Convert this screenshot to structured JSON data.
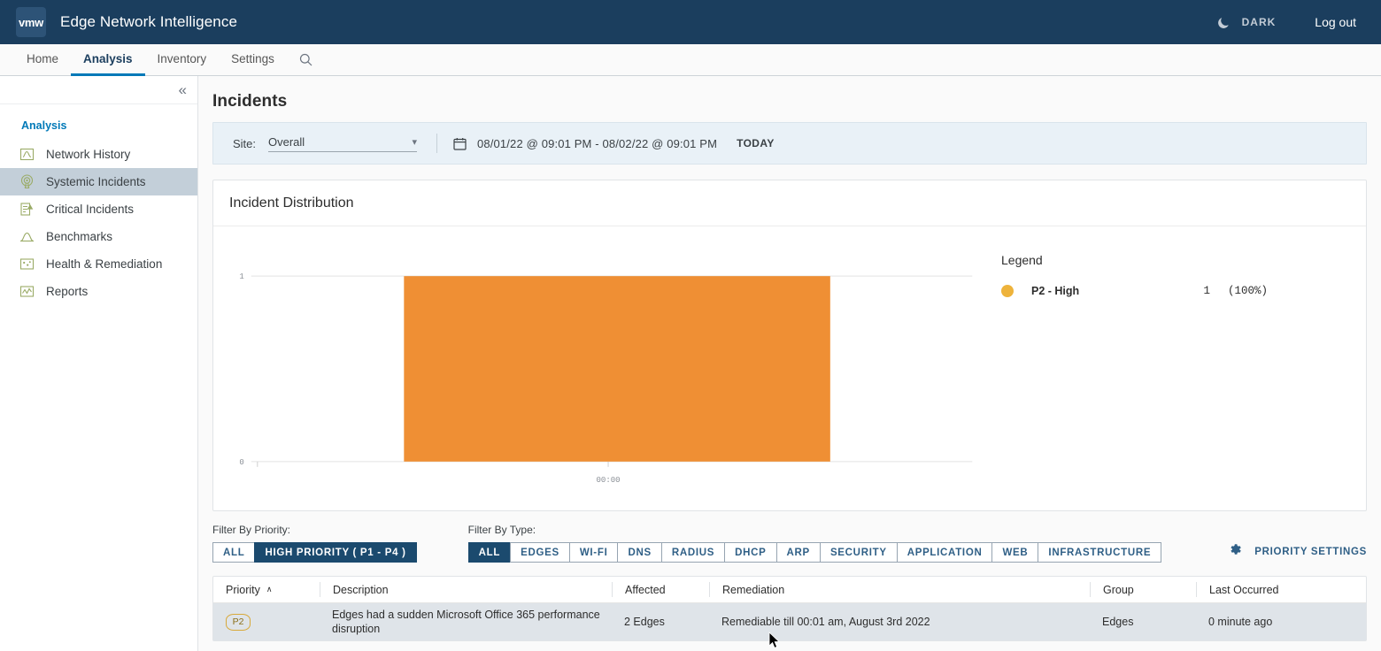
{
  "header": {
    "logo_text": "vmw",
    "app_title": "Edge Network Intelligence",
    "dark_label": "DARK",
    "logout_label": "Log out",
    "moon_icon": "moon-icon"
  },
  "nav": {
    "items": [
      {
        "label": "Home",
        "active": false
      },
      {
        "label": "Analysis",
        "active": true
      },
      {
        "label": "Inventory",
        "active": false
      },
      {
        "label": "Settings",
        "active": false
      }
    ],
    "search_icon": "search-icon"
  },
  "sidebar": {
    "collapse_icon": "«",
    "section_title": "Analysis",
    "items": [
      {
        "label": "Network History",
        "icon": "network-history-icon",
        "active": false
      },
      {
        "label": "Systemic Incidents",
        "icon": "systemic-incidents-icon",
        "active": true
      },
      {
        "label": "Critical Incidents",
        "icon": "critical-incidents-icon",
        "active": false
      },
      {
        "label": "Benchmarks",
        "icon": "benchmarks-icon",
        "active": false
      },
      {
        "label": "Health & Remediation",
        "icon": "health-remediation-icon",
        "active": false
      },
      {
        "label": "Reports",
        "icon": "reports-icon",
        "active": false
      }
    ]
  },
  "page": {
    "title": "Incidents"
  },
  "filter_strip": {
    "site_label": "Site:",
    "site_value": "Overall",
    "calendar_icon": "calendar-icon",
    "date_range": "08/01/22 @ 09:01 PM - 08/02/22 @ 09:01 PM",
    "today_label": "TODAY"
  },
  "chart_card": {
    "title": "Incident Distribution",
    "legend_title": "Legend"
  },
  "chart_data": {
    "type": "bar",
    "title": "Incident Distribution",
    "categories": [
      "00:00"
    ],
    "series": [
      {
        "name": "P2 - High",
        "values": [
          1
        ],
        "color": "#ef8f34"
      }
    ],
    "xlabel": "",
    "ylabel": "",
    "ylim": [
      0,
      1
    ],
    "yticks": [
      0,
      1
    ],
    "ytick_labels": [
      "0",
      "1"
    ],
    "xtick_labels": [
      "00:00"
    ],
    "grid": true,
    "legend_position": "right",
    "legend": [
      {
        "label": "P2 - High",
        "count": "1",
        "percent": "(100%)",
        "color": "#eeb33b"
      }
    ]
  },
  "filters": {
    "priority_caption": "Filter By Priority:",
    "priority_buttons": [
      {
        "label": "ALL",
        "selected": false
      },
      {
        "label": "HIGH PRIORITY ( P1 - P4 )",
        "selected": true
      }
    ],
    "type_caption": "Filter By Type:",
    "type_buttons": [
      {
        "label": "ALL",
        "selected": true
      },
      {
        "label": "EDGES",
        "selected": false
      },
      {
        "label": "WI-FI",
        "selected": false
      },
      {
        "label": "DNS",
        "selected": false
      },
      {
        "label": "RADIUS",
        "selected": false
      },
      {
        "label": "DHCP",
        "selected": false
      },
      {
        "label": "ARP",
        "selected": false
      },
      {
        "label": "SECURITY",
        "selected": false
      },
      {
        "label": "APPLICATION",
        "selected": false
      },
      {
        "label": "WEB",
        "selected": false
      },
      {
        "label": "INFRASTRUCTURE",
        "selected": false
      }
    ],
    "priority_settings_label": "PRIORITY SETTINGS",
    "priority_settings_icon": "gear-icon"
  },
  "table": {
    "columns": [
      "Priority",
      "Description",
      "Affected",
      "Remediation",
      "Group",
      "Last Occurred"
    ],
    "sort_column": "Priority",
    "sort_caret": "∧",
    "rows": [
      {
        "priority": "P2",
        "description": "Edges had a sudden Microsoft Office 365 performance disruption",
        "affected": "2 Edges",
        "remediation": "Remediable till 00:01 am, August 3rd 2022",
        "group": "Edges",
        "last_occurred": "0 minute ago"
      }
    ]
  },
  "colors": {
    "header_bg": "#1b3e5e",
    "accent_blue": "#0079b8",
    "bar_orange": "#ef8f34",
    "legend_amber": "#eeb33b",
    "selected_dark": "#1b4a6e"
  }
}
